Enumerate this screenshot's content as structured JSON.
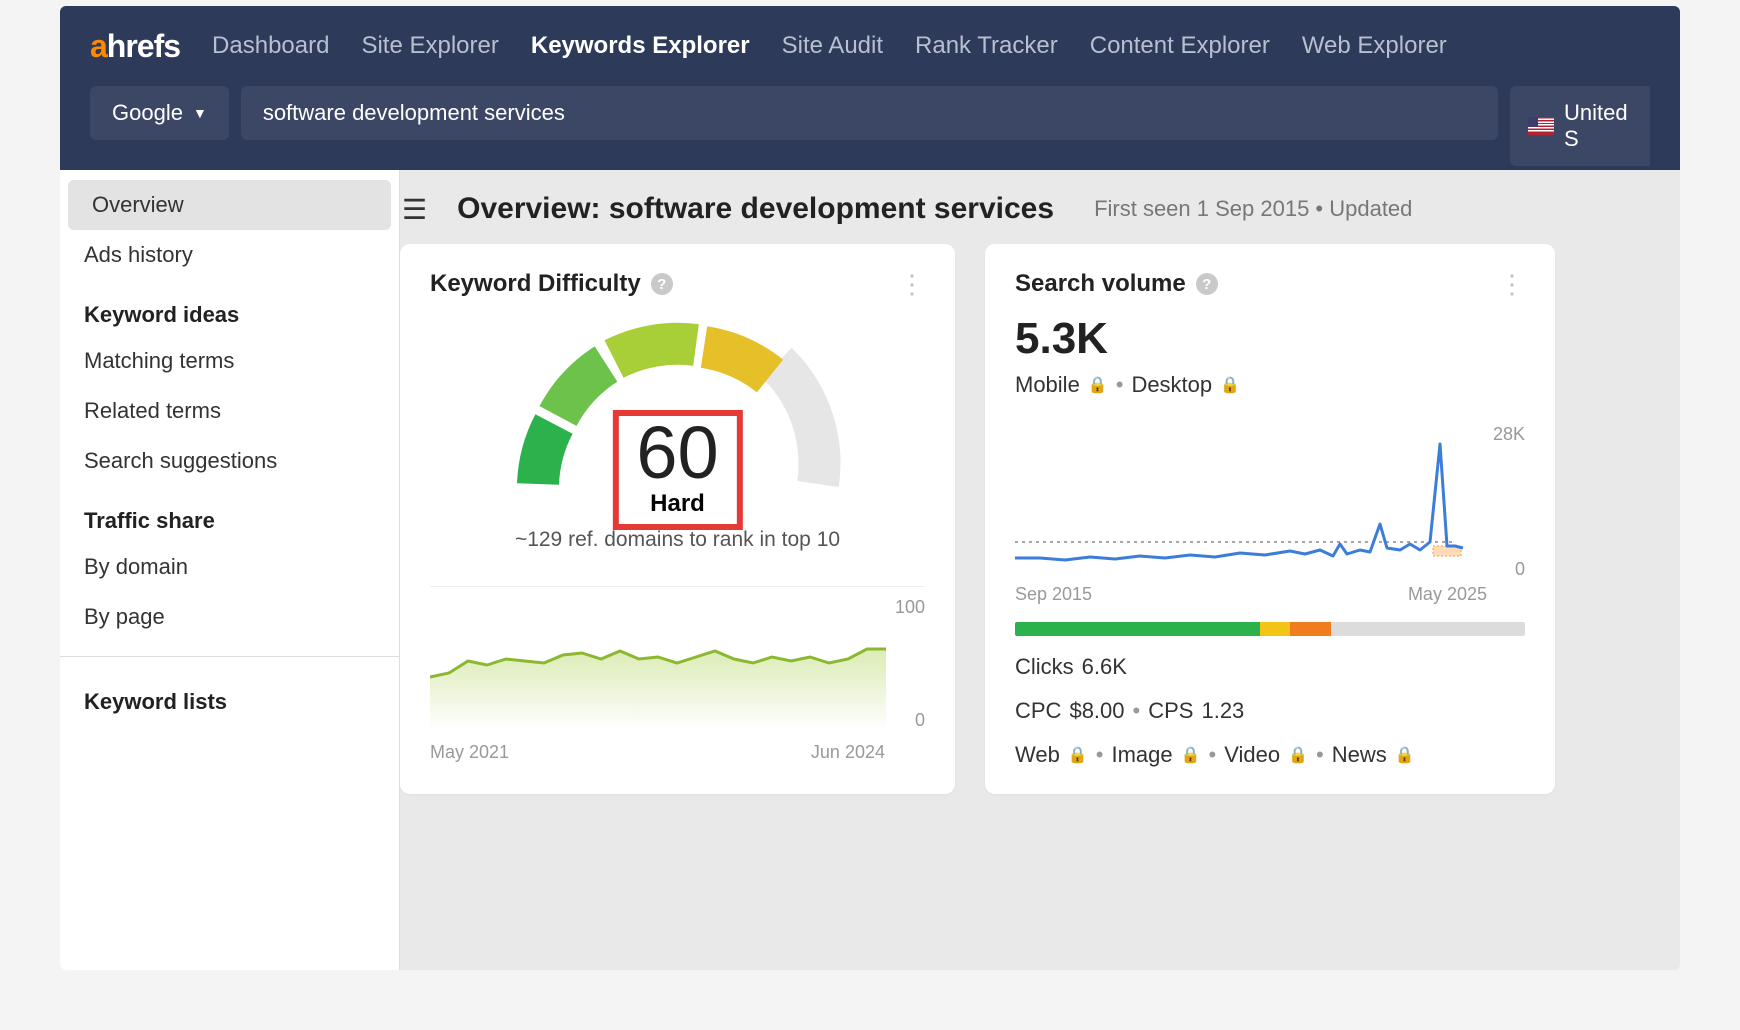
{
  "logo": {
    "a": "a",
    "rest": "hrefs"
  },
  "nav": {
    "items": [
      {
        "label": "Dashboard"
      },
      {
        "label": "Site Explorer"
      },
      {
        "label": "Keywords Explorer",
        "active": true
      },
      {
        "label": "Site Audit"
      },
      {
        "label": "Rank Tracker"
      },
      {
        "label": "Content Explorer"
      },
      {
        "label": "Web Explorer"
      }
    ]
  },
  "search": {
    "engine": "Google",
    "keyword": "software development services",
    "country": "United S"
  },
  "sidebar": {
    "primary": [
      {
        "label": "Overview",
        "active": true
      },
      {
        "label": "Ads history"
      }
    ],
    "ideas_head": "Keyword ideas",
    "ideas": [
      {
        "label": "Matching terms"
      },
      {
        "label": "Related terms"
      },
      {
        "label": "Search suggestions"
      }
    ],
    "traffic_head": "Traffic share",
    "traffic": [
      {
        "label": "By domain"
      },
      {
        "label": "By page"
      }
    ],
    "lists_head": "Keyword lists"
  },
  "header": {
    "title": "Overview: software development services",
    "meta": "First seen 1 Sep 2015  •  Updated"
  },
  "kd_card": {
    "title": "Keyword Difficulty",
    "score": "60",
    "label": "Hard",
    "note": "~129 ref. domains to rank in top 10",
    "mini_ymax": "100",
    "mini_yzero": "0",
    "mini_xstart": "May 2021",
    "mini_xend": "Jun 2024"
  },
  "sv_card": {
    "title": "Search volume",
    "value": "5.3K",
    "mobile": "Mobile",
    "desktop": "Desktop",
    "ymax": "28K",
    "yzero": "0",
    "xstart": "Sep 2015",
    "xend": "May 2025",
    "clicks_label": "Clicks",
    "clicks_value": "6.6K",
    "cpc_label": "CPC",
    "cpc_value": "$8.00",
    "cps_label": "CPS",
    "cps_value": "1.23",
    "types": [
      "Web",
      "Image",
      "Video",
      "News"
    ]
  },
  "chart_data": [
    {
      "type": "line",
      "title": "Keyword Difficulty trend",
      "x_range": [
        "May 2021",
        "Jun 2024"
      ],
      "ylim": [
        0,
        100
      ],
      "x": [
        0,
        1,
        2,
        3,
        4,
        5,
        6,
        7,
        8,
        9,
        10,
        11,
        12,
        13,
        14,
        15,
        16,
        17,
        18,
        19,
        20,
        21,
        22,
        23,
        24
      ],
      "values": [
        45,
        48,
        58,
        55,
        60,
        58,
        56,
        63,
        65,
        60,
        66,
        60,
        62,
        56,
        62,
        66,
        60,
        56,
        62,
        58,
        62,
        56,
        60,
        68,
        68
      ]
    },
    {
      "type": "line",
      "title": "Search volume trend",
      "x_range": [
        "Sep 2015",
        "May 2025"
      ],
      "ylim": [
        0,
        28000
      ],
      "series": [
        {
          "name": "Volume",
          "x": [
            0,
            5,
            10,
            15,
            20,
            25,
            30,
            35,
            40,
            45,
            50,
            55,
            60,
            65,
            68,
            70,
            72,
            74,
            78,
            80,
            82,
            85,
            88,
            90,
            92,
            94,
            95,
            96
          ],
          "values": [
            3200,
            3200,
            3000,
            3400,
            3200,
            3600,
            3200,
            3800,
            3600,
            4200,
            4000,
            4400,
            4000,
            4400,
            4200,
            5200,
            4600,
            5000,
            4600,
            9000,
            5200,
            4800,
            5200,
            4800,
            25000,
            5600,
            5600,
            5400
          ]
        }
      ],
      "baseline": 5300
    },
    {
      "type": "bar",
      "title": "SERP features distribution",
      "categories": [
        "organic-green",
        "yellow",
        "orange",
        "none"
      ],
      "values": [
        48,
        6,
        8,
        38
      ]
    }
  ]
}
